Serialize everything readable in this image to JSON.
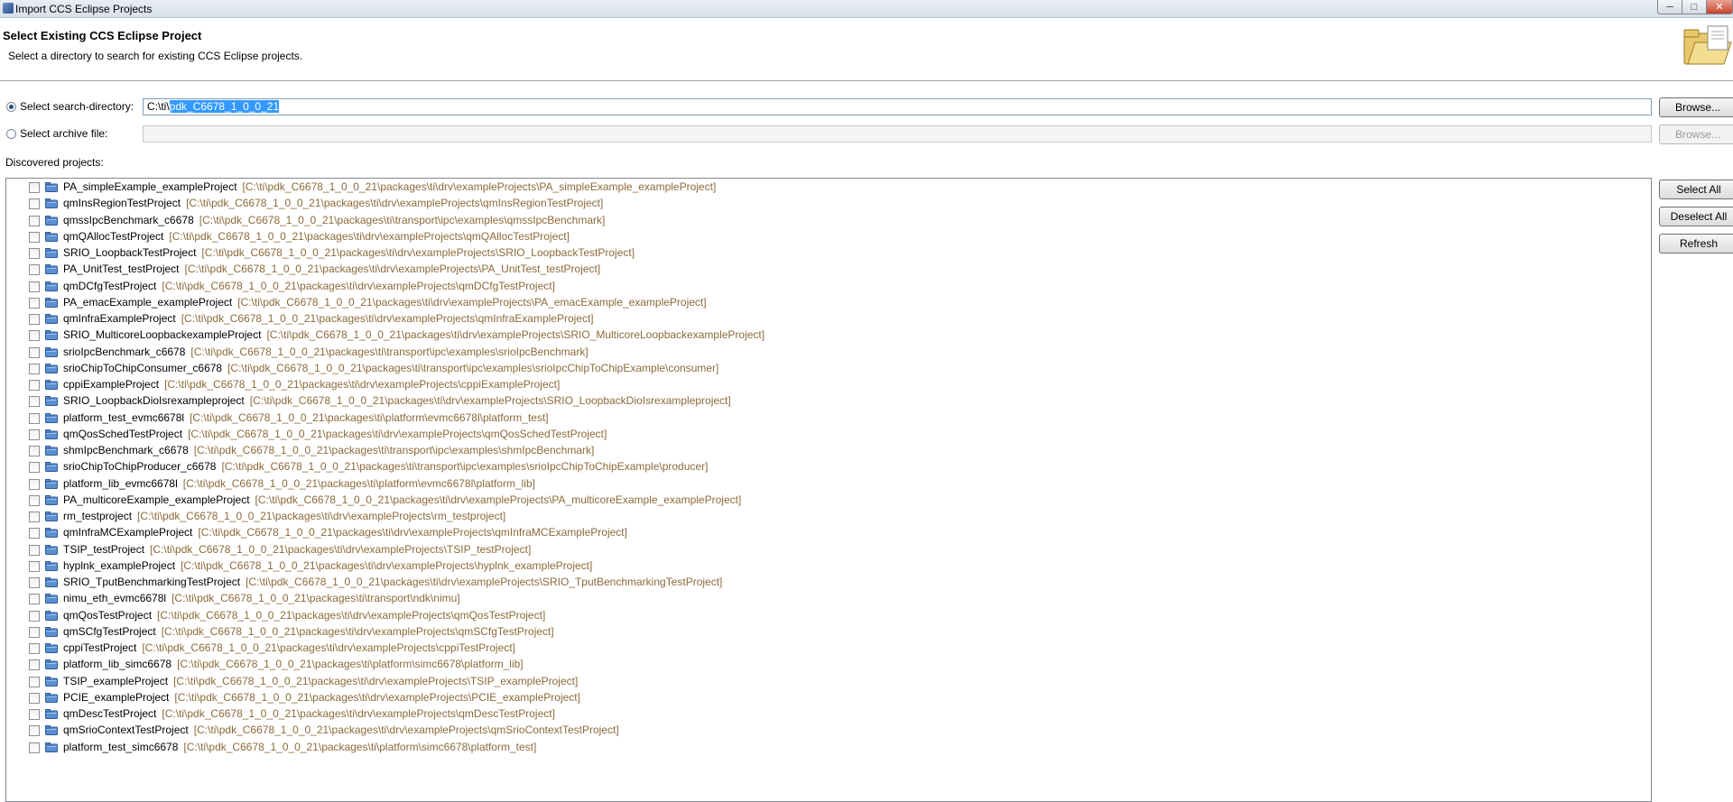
{
  "window": {
    "title": "Import CCS Eclipse Projects",
    "controls": [
      "─",
      "□",
      "✕"
    ]
  },
  "header": {
    "title": "Select Existing CCS Eclipse Project",
    "description": "Select a directory to search for existing CCS Eclipse projects."
  },
  "search_dir": {
    "label": "Select search-directory:",
    "value_prefix": "C:\\ti\\",
    "value_selected": "pdk_C6678_1_0_0_21",
    "browse_label": "Browse...",
    "checked": true
  },
  "archive": {
    "label": "Select archive file:",
    "value": "",
    "browse_label": "Browse..."
  },
  "discovered_label": "Discovered projects:",
  "buttons": {
    "select_all": "Select All",
    "deselect_all": "Deselect All",
    "refresh": "Refresh"
  },
  "projects": [
    {
      "name": "PA_simpleExample_exampleProject",
      "path": "[C:\\ti\\pdk_C6678_1_0_0_21\\packages\\ti\\drv\\exampleProjects\\PA_simpleExample_exampleProject]"
    },
    {
      "name": "qmInsRegionTestProject",
      "path": "[C:\\ti\\pdk_C6678_1_0_0_21\\packages\\ti\\drv\\exampleProjects\\qmInsRegionTestProject]"
    },
    {
      "name": "qmssIpcBenchmark_c6678",
      "path": "[C:\\ti\\pdk_C6678_1_0_0_21\\packages\\ti\\transport\\ipc\\examples\\qmssIpcBenchmark]"
    },
    {
      "name": "qmQAllocTestProject",
      "path": "[C:\\ti\\pdk_C6678_1_0_0_21\\packages\\ti\\drv\\exampleProjects\\qmQAllocTestProject]"
    },
    {
      "name": "SRIO_LoopbackTestProject",
      "path": "[C:\\ti\\pdk_C6678_1_0_0_21\\packages\\ti\\drv\\exampleProjects\\SRIO_LoopbackTestProject]"
    },
    {
      "name": "PA_UnitTest_testProject",
      "path": "[C:\\ti\\pdk_C6678_1_0_0_21\\packages\\ti\\drv\\exampleProjects\\PA_UnitTest_testProject]"
    },
    {
      "name": "qmDCfgTestProject",
      "path": "[C:\\ti\\pdk_C6678_1_0_0_21\\packages\\ti\\drv\\exampleProjects\\qmDCfgTestProject]"
    },
    {
      "name": "PA_emacExample_exampleProject",
      "path": "[C:\\ti\\pdk_C6678_1_0_0_21\\packages\\ti\\drv\\exampleProjects\\PA_emacExample_exampleProject]"
    },
    {
      "name": "qmInfraExampleProject",
      "path": "[C:\\ti\\pdk_C6678_1_0_0_21\\packages\\ti\\drv\\exampleProjects\\qmInfraExampleProject]"
    },
    {
      "name": "SRIO_MulticoreLoopbackexampleProject",
      "path": "[C:\\ti\\pdk_C6678_1_0_0_21\\packages\\ti\\drv\\exampleProjects\\SRIO_MulticoreLoopbackexampleProject]"
    },
    {
      "name": "srioIpcBenchmark_c6678",
      "path": "[C:\\ti\\pdk_C6678_1_0_0_21\\packages\\ti\\transport\\ipc\\examples\\srioIpcBenchmark]"
    },
    {
      "name": "srioChipToChipConsumer_c6678",
      "path": "[C:\\ti\\pdk_C6678_1_0_0_21\\packages\\ti\\transport\\ipc\\examples\\srioIpcChipToChipExample\\consumer]"
    },
    {
      "name": "cppiExampleProject",
      "path": "[C:\\ti\\pdk_C6678_1_0_0_21\\packages\\ti\\drv\\exampleProjects\\cppiExampleProject]"
    },
    {
      "name": "SRIO_LoopbackDioIsrexampleproject",
      "path": "[C:\\ti\\pdk_C6678_1_0_0_21\\packages\\ti\\drv\\exampleProjects\\SRIO_LoopbackDioIsrexampleproject]"
    },
    {
      "name": "platform_test_evmc6678l",
      "path": "[C:\\ti\\pdk_C6678_1_0_0_21\\packages\\ti\\platform\\evmc6678l\\platform_test]"
    },
    {
      "name": "qmQosSchedTestProject",
      "path": "[C:\\ti\\pdk_C6678_1_0_0_21\\packages\\ti\\drv\\exampleProjects\\qmQosSchedTestProject]"
    },
    {
      "name": "shmIpcBenchmark_c6678",
      "path": "[C:\\ti\\pdk_C6678_1_0_0_21\\packages\\ti\\transport\\ipc\\examples\\shmIpcBenchmark]"
    },
    {
      "name": "srioChipToChipProducer_c6678",
      "path": "[C:\\ti\\pdk_C6678_1_0_0_21\\packages\\ti\\transport\\ipc\\examples\\srioIpcChipToChipExample\\producer]"
    },
    {
      "name": "platform_lib_evmc6678l",
      "path": "[C:\\ti\\pdk_C6678_1_0_0_21\\packages\\ti\\platform\\evmc6678l\\platform_lib]"
    },
    {
      "name": "PA_multicoreExample_exampleProject",
      "path": "[C:\\ti\\pdk_C6678_1_0_0_21\\packages\\ti\\drv\\exampleProjects\\PA_multicoreExample_exampleProject]"
    },
    {
      "name": "rm_testproject",
      "path": "[C:\\ti\\pdk_C6678_1_0_0_21\\packages\\ti\\drv\\exampleProjects\\rm_testproject]"
    },
    {
      "name": "qmInfraMCExampleProject",
      "path": "[C:\\ti\\pdk_C6678_1_0_0_21\\packages\\ti\\drv\\exampleProjects\\qmInfraMCExampleProject]"
    },
    {
      "name": "TSIP_testProject",
      "path": "[C:\\ti\\pdk_C6678_1_0_0_21\\packages\\ti\\drv\\exampleProjects\\TSIP_testProject]"
    },
    {
      "name": "hyplnk_exampleProject",
      "path": "[C:\\ti\\pdk_C6678_1_0_0_21\\packages\\ti\\drv\\exampleProjects\\hyplnk_exampleProject]"
    },
    {
      "name": "SRIO_TputBenchmarkingTestProject",
      "path": "[C:\\ti\\pdk_C6678_1_0_0_21\\packages\\ti\\drv\\exampleProjects\\SRIO_TputBenchmarkingTestProject]"
    },
    {
      "name": "nimu_eth_evmc6678l",
      "path": "[C:\\ti\\pdk_C6678_1_0_0_21\\packages\\ti\\transport\\ndk\\nimu]"
    },
    {
      "name": "qmQosTestProject",
      "path": "[C:\\ti\\pdk_C6678_1_0_0_21\\packages\\ti\\drv\\exampleProjects\\qmQosTestProject]"
    },
    {
      "name": "qmSCfgTestProject",
      "path": "[C:\\ti\\pdk_C6678_1_0_0_21\\packages\\ti\\drv\\exampleProjects\\qmSCfgTestProject]"
    },
    {
      "name": "cppiTestProject",
      "path": "[C:\\ti\\pdk_C6678_1_0_0_21\\packages\\ti\\drv\\exampleProjects\\cppiTestProject]"
    },
    {
      "name": "platform_lib_simc6678",
      "path": "[C:\\ti\\pdk_C6678_1_0_0_21\\packages\\ti\\platform\\simc6678\\platform_lib]"
    },
    {
      "name": "TSIP_exampleProject",
      "path": "[C:\\ti\\pdk_C6678_1_0_0_21\\packages\\ti\\drv\\exampleProjects\\TSIP_exampleProject]"
    },
    {
      "name": "PCIE_exampleProject",
      "path": "[C:\\ti\\pdk_C6678_1_0_0_21\\packages\\ti\\drv\\exampleProjects\\PCIE_exampleProject]"
    },
    {
      "name": "qmDescTestProject",
      "path": "[C:\\ti\\pdk_C6678_1_0_0_21\\packages\\ti\\drv\\exampleProjects\\qmDescTestProject]"
    },
    {
      "name": "qmSrioContextTestProject",
      "path": "[C:\\ti\\pdk_C6678_1_0_0_21\\packages\\ti\\drv\\exampleProjects\\qmSrioContextTestProject]"
    },
    {
      "name": "platform_test_simc6678",
      "path": "[C:\\ti\\pdk_C6678_1_0_0_21\\packages\\ti\\platform\\simc6678\\platform_test]"
    }
  ],
  "colors": {
    "path_text": "#8c6a3a",
    "selection": "#3399ff",
    "folder_icon": "#4a7fc1"
  }
}
